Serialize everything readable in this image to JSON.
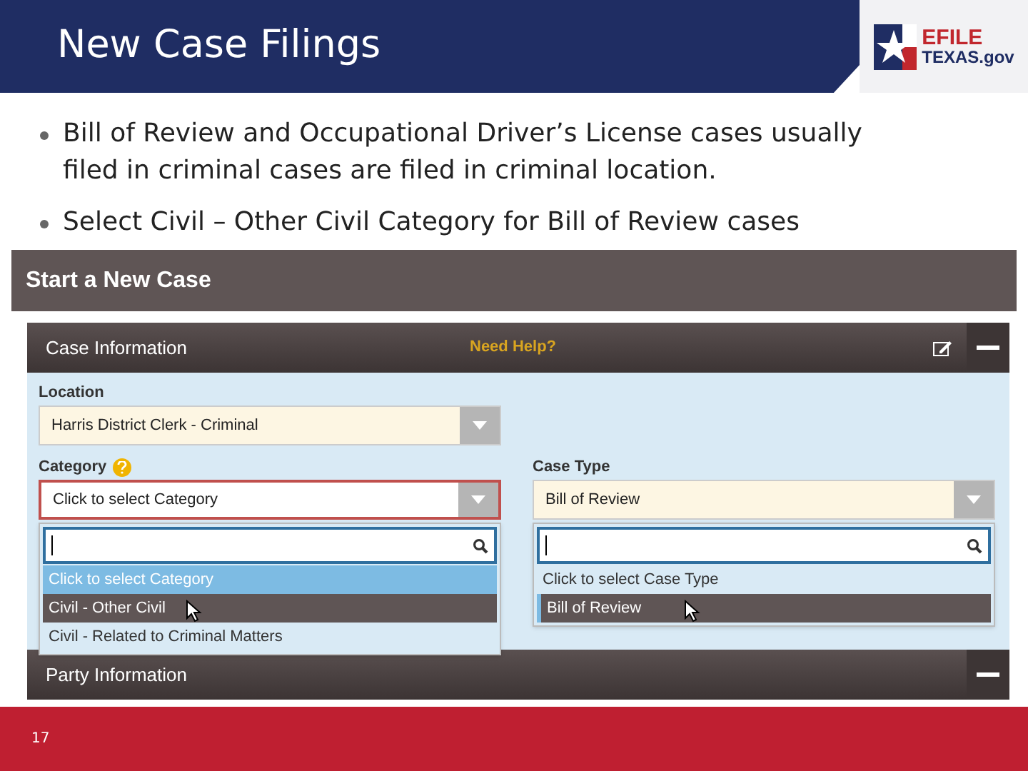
{
  "slide": {
    "title": "New Case Filings",
    "logo": {
      "line_1": "EFILE",
      "line_2": "TEXAS.gov"
    },
    "page_number": "17"
  },
  "bullets": [
    "Bill of Review and Occupational Driver’s License cases usually filed in criminal cases are filed in criminal location.",
    "Select Civil – Other Civil Category for Bill of Review cases"
  ],
  "screenshot": {
    "title": "Start a New Case",
    "section": {
      "title": "Case Information",
      "help": "Need Help?",
      "expanded": true
    },
    "fields": [
      {
        "label": "Location",
        "value": "Harris District Clerk - Criminal",
        "filled": true,
        "highlighted": false
      },
      {
        "label": "Category",
        "value": "Click to select Category",
        "filled": false,
        "highlighted": true,
        "help_icon": true,
        "open": true,
        "options": [
          {
            "label": "Click to select Category",
            "hovered": false,
            "selected": true
          },
          {
            "label": "Civil - Other Civil",
            "hovered": true,
            "selected": false
          },
          {
            "label": "Civil - Related to Criminal Matters",
            "hovered": false,
            "selected": false
          }
        ]
      },
      {
        "label": "Case Type",
        "value": "Bill of Review",
        "filled": true,
        "highlighted": false,
        "open": true,
        "options": [
          {
            "label": "Click to select Case Type",
            "hovered": false,
            "selected": false
          },
          {
            "label": "Bill of Review",
            "hovered": true,
            "selected": true
          }
        ]
      }
    ],
    "next_section": {
      "title": "Party Information",
      "expanded": true
    }
  }
}
